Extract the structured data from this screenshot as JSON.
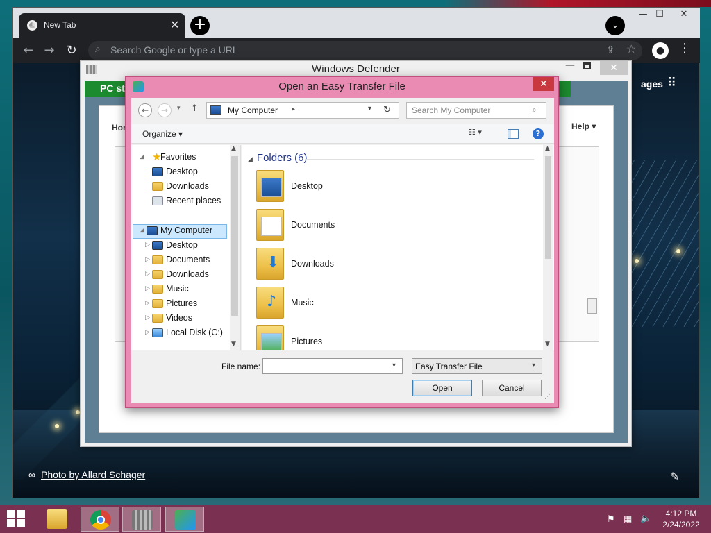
{
  "browser": {
    "tab_title": "New Tab",
    "tab_close": "✕",
    "new_tab": "+",
    "tab_search": "⌄",
    "min": "—",
    "max": "☐",
    "close": "✕",
    "back": "←",
    "forward": "→",
    "reload": "↻",
    "omnibox_placeholder": "Search Google or type a URL",
    "share_icon": "⇪",
    "bookmark_icon": "☆",
    "menu_icon": "⋮",
    "profile_icon": "●",
    "apps_icon": "⠿",
    "ntp_images_label": "ages",
    "photo_credit": "Photo by Allard Schager",
    "link_icon": "∞",
    "edit_icon": "✎"
  },
  "defender": {
    "title": "Windows Defender",
    "min": "—",
    "close": "✕",
    "status_prefix": "PC sta",
    "home_tab": "Hom",
    "help": "Help ▾"
  },
  "dialog": {
    "title": "Open an Easy Transfer File",
    "close": "✕",
    "address": {
      "label": "My Computer",
      "sep": "▸",
      "dropdown": "▾",
      "refresh": "↻"
    },
    "search_placeholder": "Search My Computer",
    "search_icon": "⌕",
    "organize": "Organize ▾",
    "view_icon": "☷ ▾",
    "help_icon": "?",
    "nav": {
      "favorites": "Favorites",
      "favorites_items": [
        "Desktop",
        "Downloads",
        "Recent places"
      ],
      "computer": "My Computer",
      "computer_items": [
        "Desktop",
        "Documents",
        "Downloads",
        "Music",
        "Pictures",
        "Videos",
        "Local Disk (C:)"
      ]
    },
    "group_header": "Folders (6)",
    "folders": [
      "Desktop",
      "Documents",
      "Downloads",
      "Music",
      "Pictures"
    ],
    "file_name_label": "File name:",
    "file_name_value": "",
    "file_type": "Easy Transfer File",
    "open_label": "Open",
    "cancel_label": "Cancel"
  },
  "taskbar": {
    "time": "4:12 PM",
    "date": "2/24/2022",
    "apps": [
      "file-explorer",
      "chrome",
      "windows-defender",
      "easy-transfer"
    ]
  }
}
